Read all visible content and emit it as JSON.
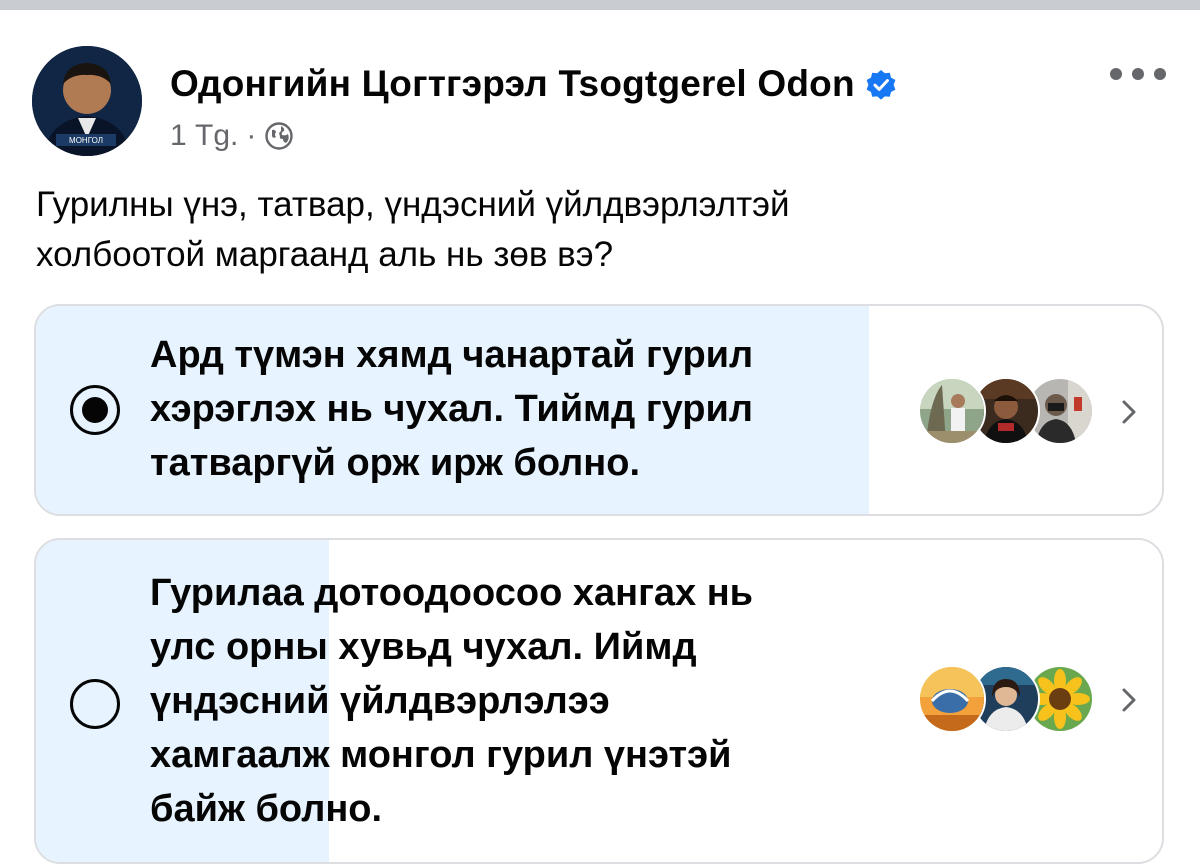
{
  "post": {
    "author_name": "Одонгийн Цогтгэрэл Tsogtgerel Odon",
    "time": "1 Тg.",
    "separator": "·",
    "question_line1": "Гурилны үнэ, татвар, үндэсний үйлдвэрлэлтэй",
    "question_line2": "холбоотой маргаанд аль нь зөв вэ?",
    "avatar_caption": "МОНГОЛ"
  },
  "icons": {
    "verified": "verified-badge-icon",
    "audience": "globe-icon",
    "menu": "more-options-icon",
    "chevron": "chevron-right-icon"
  },
  "colors": {
    "vote_fill": "#e7f3ff",
    "verified_blue": "#1877f2",
    "secondary_text": "#65676b",
    "border": "#dcdee2"
  },
  "poll": {
    "options": [
      {
        "lines": [
          "Ард түмэн хямд чанартай гурил",
          "хэрэглэх нь чухал. Тиймд гурил",
          "татваргүй орж ирж болно."
        ],
        "selected": true,
        "vote_fraction": 0.74
      },
      {
        "lines": [
          "Гурилаа дотоодоосоо хангах нь",
          "улс орны хувьд чухал. Иймд",
          "үндэсний үйлдвэрлэлээ",
          "хамгаалж монгол гурил үнэтэй",
          "байж болно."
        ],
        "selected": false,
        "vote_fraction": 0.26
      }
    ]
  }
}
